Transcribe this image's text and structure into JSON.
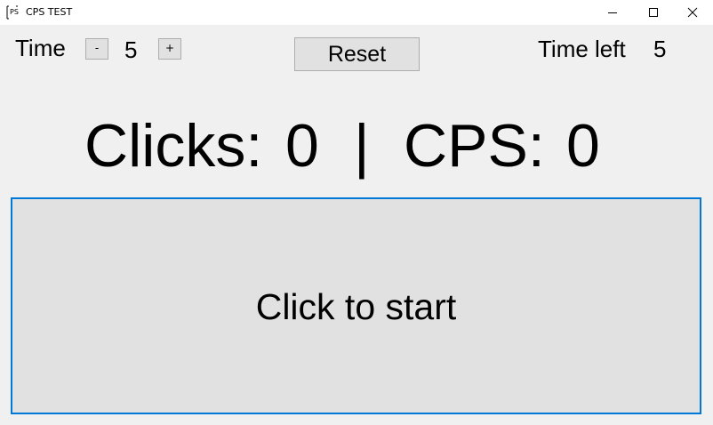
{
  "window": {
    "title": "CPS TEST",
    "controls": {
      "minimize_icon": "minimize-icon",
      "maximize_icon": "maximize-icon",
      "close_icon": "close-icon"
    }
  },
  "time_control": {
    "label": "Time",
    "decrement_label": "-",
    "value": "5",
    "increment_label": "+"
  },
  "reset_button": {
    "label": "Reset"
  },
  "time_left": {
    "label": "Time left",
    "value": "5"
  },
  "stats": {
    "clicks_label": "Clicks:",
    "clicks_value": "0",
    "separator": "|",
    "cps_label": "CPS:",
    "cps_value": "0"
  },
  "click_area": {
    "label": "Click to start"
  },
  "colors": {
    "window_bg": "#f0f0f0",
    "button_bg": "#e1e1e1",
    "button_border": "#adadad",
    "focus_border": "#0078d7"
  }
}
